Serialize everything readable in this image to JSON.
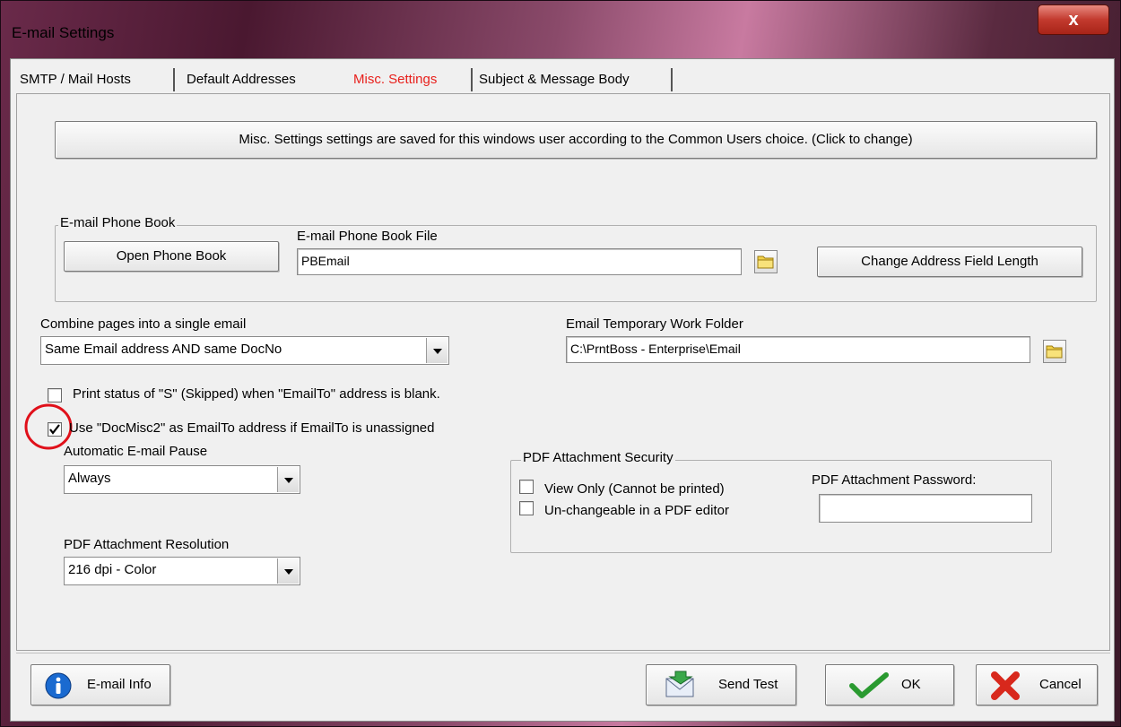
{
  "window": {
    "title": "E-mail Settings",
    "close": "x"
  },
  "tabs": [
    {
      "label": "SMTP / Mail Hosts"
    },
    {
      "label": "Default Addresses"
    },
    {
      "label": "Misc. Settings"
    },
    {
      "label": "Subject & Message Body"
    }
  ],
  "banner": "Misc. Settings settings are saved for this windows user according to the Common Users choice.   (Click to change)",
  "phonebook": {
    "group_label": "E-mail Phone Book",
    "open_button": "Open Phone Book",
    "file_label": "E-mail Phone Book File",
    "file_value": "PBEmail",
    "change_button": "Change Address Field Length"
  },
  "combine": {
    "label": "Combine pages into a single email",
    "value": "Same Email address AND same DocNo"
  },
  "temp_folder": {
    "label": "Email Temporary Work Folder",
    "value": "C:\\PrntBoss - Enterprise\\Email"
  },
  "checkboxes": {
    "print_status": {
      "label": "Print status of \"S\" (Skipped)  when \"EmailTo\" address is blank.",
      "checked": false
    },
    "use_docmisc2": {
      "label": "Use \"DocMisc2\" as EmailTo address if EmailTo is unassigned",
      "checked": true
    }
  },
  "pause": {
    "label": "Automatic E-mail Pause",
    "value": "Always"
  },
  "resolution": {
    "label": "PDF Attachment Resolution",
    "value": "216 dpi - Color"
  },
  "security": {
    "group_label": "PDF Attachment Security",
    "view_only": "View Only (Cannot be printed)",
    "unchangeable": "Un-changeable in a PDF editor",
    "password_label": "PDF Attachment Password:",
    "password_value": ""
  },
  "footer": {
    "info": "E-mail Info",
    "send_test": "Send Test",
    "ok": "OK",
    "cancel": "Cancel"
  },
  "colors": {
    "active_tab": "#e8201c",
    "highlight_circle": "#e0101a"
  }
}
